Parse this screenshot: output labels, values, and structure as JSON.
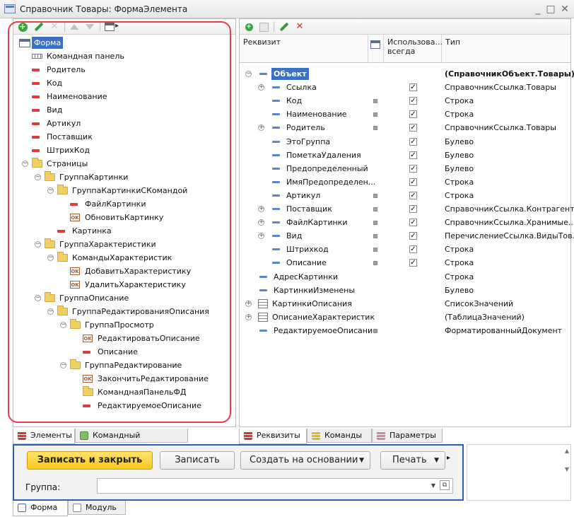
{
  "window": {
    "title": "Справочник Товары: ФормаЭлемента"
  },
  "left_panel": {
    "items": [
      {
        "label": "Форма",
        "level": 0,
        "icon": "form-icon",
        "expander": "",
        "selected": true
      },
      {
        "label": "Командная панель",
        "level": 1,
        "icon": "command-bar-icon",
        "expander": ""
      },
      {
        "label": "Родитель",
        "level": 1,
        "icon": "field-icon",
        "expander": ""
      },
      {
        "label": "Код",
        "level": 1,
        "icon": "field-icon",
        "expander": ""
      },
      {
        "label": "Наименование",
        "level": 1,
        "icon": "field-icon",
        "expander": ""
      },
      {
        "label": "Вид",
        "level": 1,
        "icon": "field-icon",
        "expander": ""
      },
      {
        "label": "Артикул",
        "level": 1,
        "icon": "field-icon",
        "expander": ""
      },
      {
        "label": "Поставщик",
        "level": 1,
        "icon": "field-icon",
        "expander": ""
      },
      {
        "label": "ШтрихКод",
        "level": 1,
        "icon": "field-icon",
        "expander": ""
      },
      {
        "label": "Страницы",
        "level": 1,
        "icon": "folder-icon",
        "expander": "−"
      },
      {
        "label": "ГруппаКартинки",
        "level": 2,
        "icon": "folder-icon",
        "expander": "−"
      },
      {
        "label": "ГруппаКартинкиСКомандой",
        "level": 3,
        "icon": "folder-icon",
        "expander": "−"
      },
      {
        "label": "ФайлКартинки",
        "level": 4,
        "icon": "field-icon",
        "expander": ""
      },
      {
        "label": "ОбновитьКартинку",
        "level": 4,
        "icon": "ok-icon",
        "expander": ""
      },
      {
        "label": "Картинка",
        "level": 3,
        "icon": "field-icon",
        "expander": ""
      },
      {
        "label": "ГруппаХарактеристики",
        "level": 2,
        "icon": "folder-icon",
        "expander": "−"
      },
      {
        "label": "КомандыХарактеристик",
        "level": 3,
        "icon": "folder-icon",
        "expander": "−"
      },
      {
        "label": "ДобавитьХарактеристику",
        "level": 4,
        "icon": "ok-icon",
        "expander": ""
      },
      {
        "label": "УдалитьХарактеристику",
        "level": 4,
        "icon": "ok-icon",
        "expander": ""
      },
      {
        "label": "ГруппаОписание",
        "level": 2,
        "icon": "folder-icon",
        "expander": "−"
      },
      {
        "label": "ГруппаРедактированияОписания",
        "level": 3,
        "icon": "folder-icon",
        "expander": "−"
      },
      {
        "label": "ГруппаПросмотр",
        "level": 4,
        "icon": "folder-icon",
        "expander": "−"
      },
      {
        "label": "РедактироватьОписание",
        "level": 5,
        "icon": "ok-icon",
        "expander": ""
      },
      {
        "label": "Описание",
        "level": 5,
        "icon": "field-icon",
        "expander": ""
      },
      {
        "label": "ГруппаРедактирование",
        "level": 4,
        "icon": "folder-icon",
        "expander": "−"
      },
      {
        "label": "ЗакончитьРедактирование",
        "level": 5,
        "icon": "ok-icon",
        "expander": ""
      },
      {
        "label": "КоманднаяПанельФД",
        "level": 5,
        "icon": "folder-icon",
        "expander": ""
      },
      {
        "label": "РедактируемоеОписание",
        "level": 5,
        "icon": "field-icon",
        "expander": ""
      }
    ],
    "tabs": [
      {
        "label": "Элементы",
        "active": true,
        "icon": "elements"
      },
      {
        "label": "Командный интерфейс",
        "active": false,
        "icon": "cmdif"
      }
    ]
  },
  "right_panel": {
    "columns": {
      "requisite": "Реквизит",
      "used": "Использова... всегда",
      "type": "Тип"
    },
    "rows": [
      {
        "label": "Объект",
        "level": 0,
        "expander": "−",
        "box": false,
        "check": false,
        "type": "(СправочникОбъект.Товары)",
        "bold": true,
        "selected": true
      },
      {
        "label": "Ссылка",
        "level": 1,
        "expander": "+",
        "box": false,
        "check": true,
        "type": "СправочникСсылка.Товары"
      },
      {
        "label": "Код",
        "level": 1,
        "expander": "",
        "box": true,
        "check": true,
        "type": "Строка"
      },
      {
        "label": "Наименование",
        "level": 1,
        "expander": "",
        "box": true,
        "check": true,
        "type": "Строка"
      },
      {
        "label": "Родитель",
        "level": 1,
        "expander": "+",
        "box": true,
        "check": true,
        "type": "СправочникСсылка.Товары"
      },
      {
        "label": "ЭтоГруппа",
        "level": 1,
        "expander": "",
        "box": false,
        "check": true,
        "type": "Булево"
      },
      {
        "label": "ПометкаУдаления",
        "level": 1,
        "expander": "",
        "box": false,
        "check": true,
        "type": "Булево"
      },
      {
        "label": "Предопределенный",
        "level": 1,
        "expander": "",
        "box": false,
        "check": true,
        "type": "Булево"
      },
      {
        "label": "ИмяПредопределен...",
        "level": 1,
        "expander": "",
        "box": false,
        "check": true,
        "type": "Строка"
      },
      {
        "label": "Артикул",
        "level": 1,
        "expander": "",
        "box": true,
        "check": true,
        "type": "Строка"
      },
      {
        "label": "Поставщик",
        "level": 1,
        "expander": "+",
        "box": true,
        "check": true,
        "type": "СправочникСсылка.Контрагенты"
      },
      {
        "label": "ФайлКартинки",
        "level": 1,
        "expander": "+",
        "box": true,
        "check": true,
        "type": "СправочникСсылка.Хранимые..."
      },
      {
        "label": "Вид",
        "level": 1,
        "expander": "+",
        "box": true,
        "check": true,
        "type": "ПеречислениеСсылка.ВидыТов..."
      },
      {
        "label": "Штрихкод",
        "level": 1,
        "expander": "",
        "box": true,
        "check": true,
        "type": "Строка"
      },
      {
        "label": "Описание",
        "level": 1,
        "expander": "",
        "box": true,
        "check": true,
        "type": "Строка"
      },
      {
        "label": "АдресКартинки",
        "level": 0,
        "expander": "",
        "box": false,
        "check": false,
        "type": "Строка"
      },
      {
        "label": "КартинкиИзменены",
        "level": 0,
        "expander": "",
        "box": false,
        "check": false,
        "type": "Булево"
      },
      {
        "label": "КартинкиОписания",
        "level": 0,
        "expander": "+",
        "box": false,
        "check": false,
        "type": "СписокЗначений",
        "table": true
      },
      {
        "label": "ОписаниеХарактеристик",
        "level": 0,
        "expander": "+",
        "box": false,
        "check": false,
        "type": "(ТаблицаЗначений)",
        "table": true
      },
      {
        "label": "РедактируемоеОписание",
        "level": 0,
        "expander": "",
        "box": true,
        "check": false,
        "type": "ФорматированныйДокумент"
      }
    ],
    "tabs": [
      {
        "label": "Реквизиты",
        "active": true,
        "icon": "elements"
      },
      {
        "label": "Команды",
        "active": false,
        "icon": "yellow"
      },
      {
        "label": "Параметры",
        "active": false,
        "icon": "paramsic"
      }
    ]
  },
  "preview": {
    "btn_write_close": "Записать и закрыть",
    "btn_write": "Записать",
    "btn_create_based": "Создать на основании",
    "btn_print": "Печать",
    "group_label": "Группа:",
    "group_value": ""
  },
  "bottom_tabs": [
    {
      "label": "Форма",
      "active": true,
      "icon": "formic"
    },
    {
      "label": "Модуль",
      "active": false,
      "icon": "modic"
    }
  ]
}
